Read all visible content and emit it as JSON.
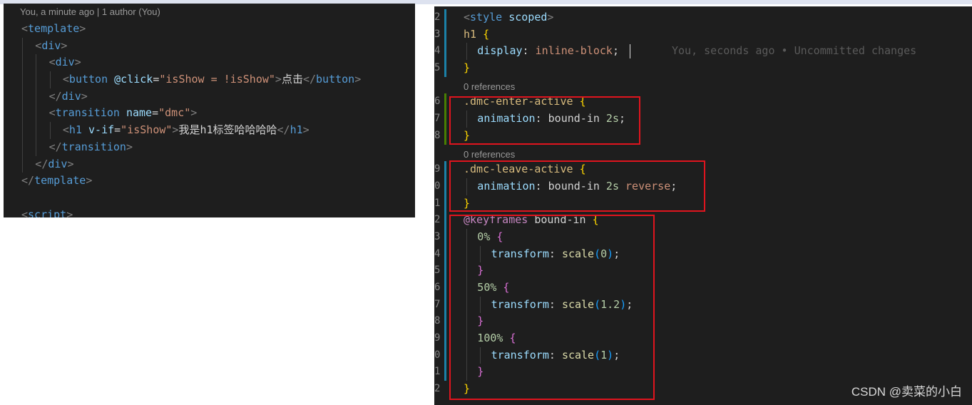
{
  "left_editor": {
    "blame": "You, a minute ago | 1 author (You)",
    "lines": [
      {
        "indent": 0,
        "parts": [
          [
            "<",
            "brk"
          ],
          [
            "template",
            "tag"
          ],
          [
            ">",
            "brk"
          ]
        ]
      },
      {
        "indent": 1,
        "parts": [
          [
            "<",
            "brk"
          ],
          [
            "div",
            "tag"
          ],
          [
            ">",
            "brk"
          ]
        ]
      },
      {
        "indent": 2,
        "parts": [
          [
            "<",
            "brk"
          ],
          [
            "div",
            "tag"
          ],
          [
            ">",
            "brk"
          ]
        ]
      },
      {
        "indent": 3,
        "parts": [
          [
            "<",
            "brk"
          ],
          [
            "button",
            "tag"
          ],
          [
            " ",
            "txt"
          ],
          [
            "@click",
            "attr"
          ],
          [
            "=",
            "txt"
          ],
          [
            "\"isShow = !isShow\"",
            "str"
          ],
          [
            ">",
            "brk"
          ],
          [
            "点击",
            "txt"
          ],
          [
            "</",
            "brk"
          ],
          [
            "button",
            "tag"
          ],
          [
            ">",
            "brk"
          ]
        ]
      },
      {
        "indent": 2,
        "parts": [
          [
            "</",
            "brk"
          ],
          [
            "div",
            "tag"
          ],
          [
            ">",
            "brk"
          ]
        ]
      },
      {
        "indent": 2,
        "parts": [
          [
            "<",
            "brk"
          ],
          [
            "transition",
            "tag"
          ],
          [
            " ",
            "txt"
          ],
          [
            "name",
            "attr"
          ],
          [
            "=",
            "txt"
          ],
          [
            "\"dmc\"",
            "str"
          ],
          [
            ">",
            "brk"
          ]
        ]
      },
      {
        "indent": 3,
        "parts": [
          [
            "<",
            "brk"
          ],
          [
            "h1",
            "tag"
          ],
          [
            " ",
            "txt"
          ],
          [
            "v-if",
            "attr"
          ],
          [
            "=",
            "txt"
          ],
          [
            "\"isShow\"",
            "str"
          ],
          [
            ">",
            "brk"
          ],
          [
            "我是h1标签哈哈哈哈",
            "txt"
          ],
          [
            "</",
            "brk"
          ],
          [
            "h1",
            "tag"
          ],
          [
            ">",
            "brk"
          ]
        ]
      },
      {
        "indent": 2,
        "parts": [
          [
            "</",
            "brk"
          ],
          [
            "transition",
            "tag"
          ],
          [
            ">",
            "brk"
          ]
        ]
      },
      {
        "indent": 1,
        "parts": [
          [
            "</",
            "brk"
          ],
          [
            "div",
            "tag"
          ],
          [
            ">",
            "brk"
          ]
        ]
      },
      {
        "indent": 0,
        "parts": [
          [
            "</",
            "brk"
          ],
          [
            "template",
            "tag"
          ],
          [
            ">",
            "brk"
          ]
        ]
      },
      {
        "indent": 0,
        "parts": []
      },
      {
        "indent": 0,
        "parts": [
          [
            "<",
            "brk"
          ],
          [
            "script",
            "tag"
          ],
          [
            ">",
            "brk"
          ]
        ]
      }
    ]
  },
  "right_editor": {
    "inline_blame": "You, seconds ago • Uncommitted changes",
    "references_label": "0 references",
    "lines": [
      {
        "num": "2",
        "bar": "blue",
        "indent": 0,
        "parts": [
          [
            "<",
            "brk"
          ],
          [
            "style",
            "tag"
          ],
          [
            " ",
            "txt"
          ],
          [
            "scoped",
            "attr"
          ],
          [
            ">",
            "brk"
          ]
        ]
      },
      {
        "num": "3",
        "bar": "blue",
        "indent": 0,
        "parts": [
          [
            "h1",
            "sel"
          ],
          [
            " ",
            "txt"
          ],
          [
            "{",
            "b1"
          ]
        ]
      },
      {
        "num": "4",
        "bar": "blue",
        "indent": 1,
        "blame": true,
        "parts": [
          [
            "display",
            "prop"
          ],
          [
            ": ",
            "txt"
          ],
          [
            "inline-block",
            "val"
          ],
          [
            ";",
            "txt"
          ]
        ]
      },
      {
        "num": "5",
        "bar": "blue",
        "indent": 0,
        "parts": [
          [
            "}",
            "b1"
          ]
        ]
      },
      {
        "ref": true
      },
      {
        "num": "6",
        "bar": "green",
        "indent": 0,
        "parts": [
          [
            ".dmc-enter-active",
            "sel"
          ],
          [
            " ",
            "txt"
          ],
          [
            "{",
            "b1"
          ]
        ]
      },
      {
        "num": "7",
        "bar": "green",
        "indent": 1,
        "parts": [
          [
            "animation",
            "prop"
          ],
          [
            ": ",
            "txt"
          ],
          [
            "bound-in",
            "txt"
          ],
          [
            " ",
            "txt"
          ],
          [
            "2s",
            "num2"
          ],
          [
            ";",
            "txt"
          ]
        ]
      },
      {
        "num": "8",
        "bar": "green",
        "indent": 0,
        "parts": [
          [
            "}",
            "b1"
          ]
        ]
      },
      {
        "ref": true
      },
      {
        "num": "9",
        "bar": "blue",
        "indent": 0,
        "parts": [
          [
            ".dmc-leave-active",
            "sel"
          ],
          [
            " ",
            "txt"
          ],
          [
            "{",
            "b1"
          ]
        ]
      },
      {
        "num": "0",
        "bar": "blue",
        "indent": 1,
        "parts": [
          [
            "animation",
            "prop"
          ],
          [
            ": ",
            "txt"
          ],
          [
            "bound-in",
            "txt"
          ],
          [
            " ",
            "txt"
          ],
          [
            "2s",
            "num2"
          ],
          [
            " ",
            "txt"
          ],
          [
            "reverse",
            "val"
          ],
          [
            ";",
            "txt"
          ]
        ]
      },
      {
        "num": "1",
        "bar": "blue",
        "indent": 0,
        "parts": [
          [
            "}",
            "b1"
          ]
        ]
      },
      {
        "num": "2",
        "bar": "blue",
        "indent": 0,
        "parts": [
          [
            "@keyframes",
            "kw"
          ],
          [
            " ",
            "txt"
          ],
          [
            "bound-in",
            "txt"
          ],
          [
            " ",
            "txt"
          ],
          [
            "{",
            "b1"
          ]
        ]
      },
      {
        "num": "3",
        "bar": "blue",
        "indent": 1,
        "parts": [
          [
            "0%",
            "num2"
          ],
          [
            " ",
            "txt"
          ],
          [
            "{",
            "b2"
          ]
        ]
      },
      {
        "num": "4",
        "bar": "blue",
        "indent": 2,
        "parts": [
          [
            "transform",
            "prop"
          ],
          [
            ": ",
            "txt"
          ],
          [
            "scale",
            "fn"
          ],
          [
            "(",
            "b3"
          ],
          [
            "0",
            "num2"
          ],
          [
            ")",
            "b3"
          ],
          [
            ";",
            "txt"
          ]
        ]
      },
      {
        "num": "5",
        "bar": "blue",
        "indent": 1,
        "parts": [
          [
            "}",
            "b2"
          ]
        ]
      },
      {
        "num": "6",
        "bar": "blue",
        "indent": 1,
        "parts": [
          [
            "50%",
            "num2"
          ],
          [
            " ",
            "txt"
          ],
          [
            "{",
            "b2"
          ]
        ]
      },
      {
        "num": "7",
        "bar": "blue",
        "indent": 2,
        "parts": [
          [
            "transform",
            "prop"
          ],
          [
            ": ",
            "txt"
          ],
          [
            "scale",
            "fn"
          ],
          [
            "(",
            "b3"
          ],
          [
            "1.2",
            "num2"
          ],
          [
            ")",
            "b3"
          ],
          [
            ";",
            "txt"
          ]
        ]
      },
      {
        "num": "8",
        "bar": "blue",
        "indent": 1,
        "parts": [
          [
            "}",
            "b2"
          ]
        ]
      },
      {
        "num": "9",
        "bar": "blue",
        "indent": 1,
        "parts": [
          [
            "100%",
            "num2"
          ],
          [
            " ",
            "txt"
          ],
          [
            "{",
            "b2"
          ]
        ]
      },
      {
        "num": "0",
        "bar": "blue",
        "indent": 2,
        "parts": [
          [
            "transform",
            "prop"
          ],
          [
            ": ",
            "txt"
          ],
          [
            "scale",
            "fn"
          ],
          [
            "(",
            "b3"
          ],
          [
            "1",
            "num2"
          ],
          [
            ")",
            "b3"
          ],
          [
            ";",
            "txt"
          ]
        ]
      },
      {
        "num": "1",
        "bar": "blue",
        "indent": 1,
        "parts": [
          [
            "}",
            "b2"
          ]
        ]
      },
      {
        "num": "2",
        "bar": "none",
        "indent": 0,
        "parts": [
          [
            "}",
            "b1"
          ]
        ]
      }
    ]
  },
  "watermark": "CSDN @卖菜的小白",
  "colors": {
    "editor_bg": "#1e1e1e",
    "highlight_box": "#e0141e",
    "git_modified": "#1b81a8",
    "git_added": "#487e02"
  }
}
